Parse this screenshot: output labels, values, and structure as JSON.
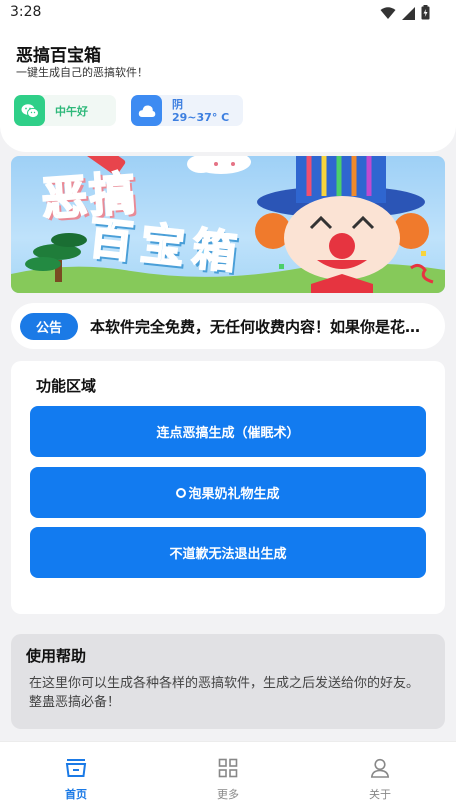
{
  "status_bar": {
    "time": "3:28",
    "icons": [
      "wifi-icon",
      "signal-icon",
      "battery-icon"
    ]
  },
  "header": {
    "title": "恶搞百宝箱",
    "subtitle": "一键生成自己的恶搞软件！",
    "greeting_chip": {
      "icon": "wechat-icon",
      "text": "中午好"
    },
    "weather_chip": {
      "icon": "cloud-icon",
      "condition": "阴",
      "temperature": "29~37° C"
    }
  },
  "banner": {
    "title_line1": "恶搞",
    "title_line2": "百宝箱"
  },
  "notice": {
    "badge": "公告",
    "text": "本软件完全免费，无任何收费内容！如果你是花钱买的，那你被骗了！"
  },
  "functions": {
    "title": "功能区域",
    "buttons": [
      {
        "label": "连点恶搞生成（催眠术）"
      },
      {
        "label": "泡果奶礼物生成",
        "icon": "ring-icon"
      },
      {
        "label": "不道歉无法退出生成"
      }
    ]
  },
  "help": {
    "title": "使用帮助",
    "text": "在这里你可以生成各种各样的恶搞软件，生成之后发送给你的好友。整蛊恶搞必备！"
  },
  "bottom_nav": {
    "items": [
      {
        "label": "首页",
        "icon": "home-icon",
        "active": true
      },
      {
        "label": "更多",
        "icon": "grid-icon",
        "active": false
      },
      {
        "label": "关于",
        "icon": "user-icon",
        "active": false
      }
    ]
  },
  "colors": {
    "primary": "#127bf0",
    "greet_accent": "#2fcf88",
    "weather_accent": "#3d8bf2",
    "page_bg": "#f2f2f4"
  }
}
